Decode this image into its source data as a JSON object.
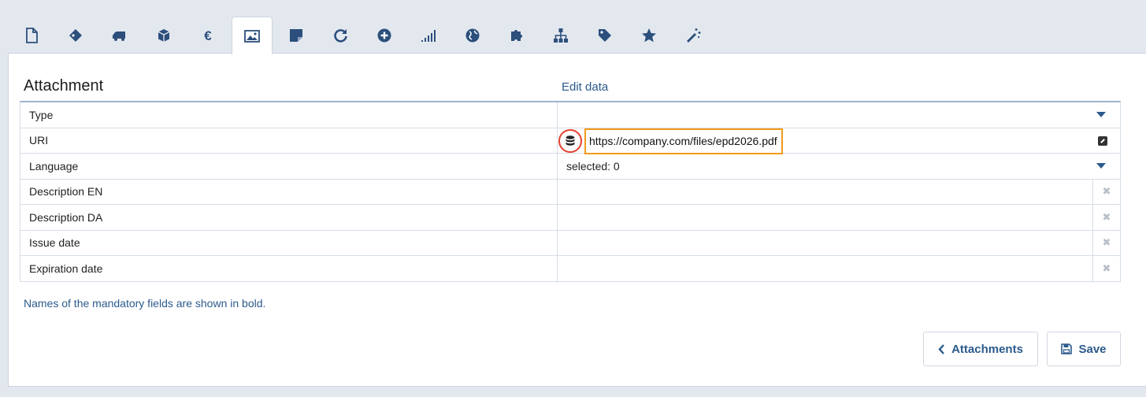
{
  "tabs": [
    {
      "name": "tab-document",
      "icon": "file-icon"
    },
    {
      "name": "tab-tags",
      "icon": "tags-icon"
    },
    {
      "name": "tab-transport",
      "icon": "truck-icon"
    },
    {
      "name": "tab-package",
      "icon": "cube-icon"
    },
    {
      "name": "tab-price",
      "icon": "euro-icon"
    },
    {
      "name": "tab-attachment",
      "icon": "image-icon",
      "active": true
    },
    {
      "name": "tab-note",
      "icon": "note-icon"
    },
    {
      "name": "tab-sync",
      "icon": "refresh-icon"
    },
    {
      "name": "tab-add",
      "icon": "plus-circle-icon"
    },
    {
      "name": "tab-signal",
      "icon": "signal-icon"
    },
    {
      "name": "tab-globe",
      "icon": "globe-icon"
    },
    {
      "name": "tab-puzzle",
      "icon": "puzzle-icon"
    },
    {
      "name": "tab-hierarchy",
      "icon": "sitemap-icon"
    },
    {
      "name": "tab-tag",
      "icon": "tag-icon"
    },
    {
      "name": "tab-star",
      "icon": "star-icon"
    },
    {
      "name": "tab-magic",
      "icon": "magic-wand-icon"
    }
  ],
  "section": {
    "title": "Attachment",
    "edit_link": "Edit data"
  },
  "fields": {
    "type": {
      "label": "Type",
      "value": ""
    },
    "uri": {
      "label": "URI",
      "value": "https://company.com/files/epd2026.pdf"
    },
    "language": {
      "label": "Language",
      "value": "selected: 0"
    },
    "description_en": {
      "label": "Description EN",
      "value": ""
    },
    "description_da": {
      "label": "Description DA",
      "value": ""
    },
    "issue_date": {
      "label": "Issue date",
      "value": ""
    },
    "expiration_date": {
      "label": "Expiration date",
      "value": ""
    }
  },
  "note": "Names of the mandatory fields are shown in bold.",
  "buttons": {
    "back": "Attachments",
    "save": "Save"
  },
  "colors": {
    "accent": "#2c5a8c",
    "highlight_circle": "#e5402f",
    "highlight_box": "#f39a1b"
  }
}
